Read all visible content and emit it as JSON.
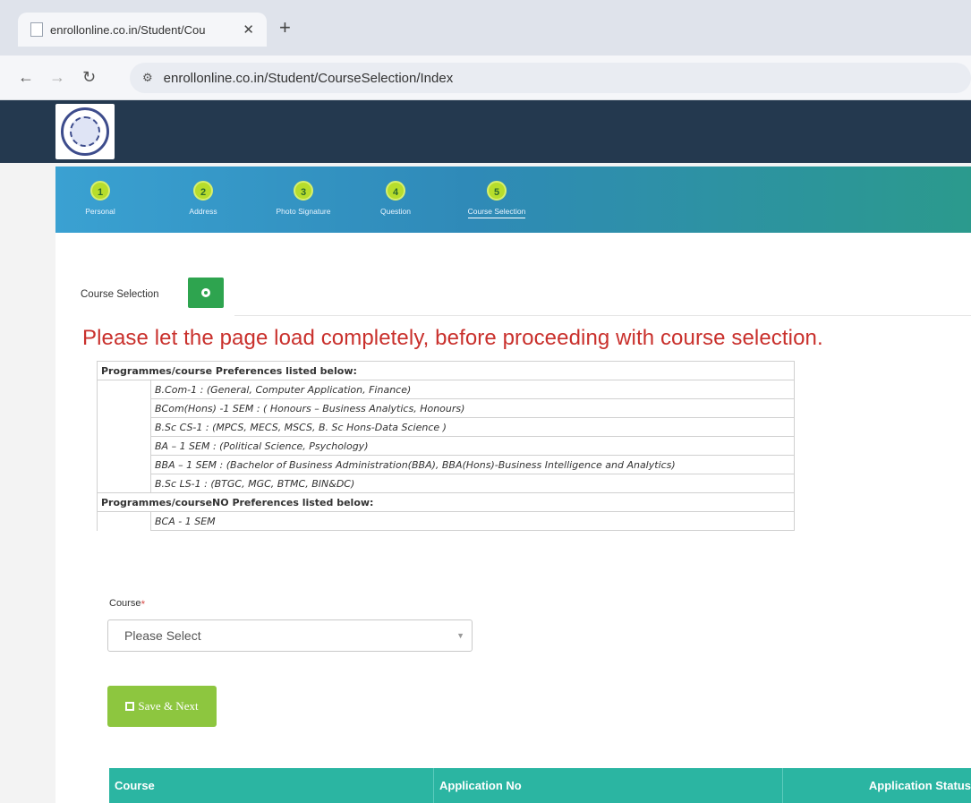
{
  "browser": {
    "tab_title": "enrollonline.co.in/Student/Cou",
    "tab_close": "✕",
    "new_tab": "+",
    "url": "enrollonline.co.in/Student/CourseSelection/Index"
  },
  "wizard": {
    "steps": [
      {
        "num": "1",
        "label": "Personal"
      },
      {
        "num": "2",
        "label": "Address"
      },
      {
        "num": "3",
        "label": "Photo Signature"
      },
      {
        "num": "4",
        "label": "Question"
      },
      {
        "num": "5",
        "label": "Course Selection"
      }
    ]
  },
  "section": {
    "title": "Course Selection"
  },
  "warning": "Please let the page load completely, before proceeding with course selection.",
  "preferences": {
    "heading_yes": "Programmes/course Preferences listed below:",
    "items_yes": [
      "B.Com-1 :  (General, Computer Application, Finance)",
      "BCom(Hons) -1 SEM : ( Honours – Business Analytics,  Honours)",
      "B.Sc CS-1 : (MPCS, MECS, MSCS, B. Sc Hons-Data Science )",
      "BA – 1 SEM : (Political Science, Psychology)",
      "BBA – 1 SEM : (Bachelor of Business Administration(BBA), BBA(Hons)-Business Intelligence and Analytics)",
      "B.Sc LS-1 : (BTGC, MGC, BTMC, BIN&DC)"
    ],
    "heading_no": "Programmes/courseNO  Preferences listed below:",
    "items_no": [
      "BCA - 1 SEM"
    ]
  },
  "form": {
    "course_label": "Course",
    "course_required": "*",
    "course_value": "Please Select",
    "save_label": "Save & Next"
  },
  "results_table": {
    "columns": [
      "Course",
      "Application No",
      "Application Status"
    ]
  }
}
